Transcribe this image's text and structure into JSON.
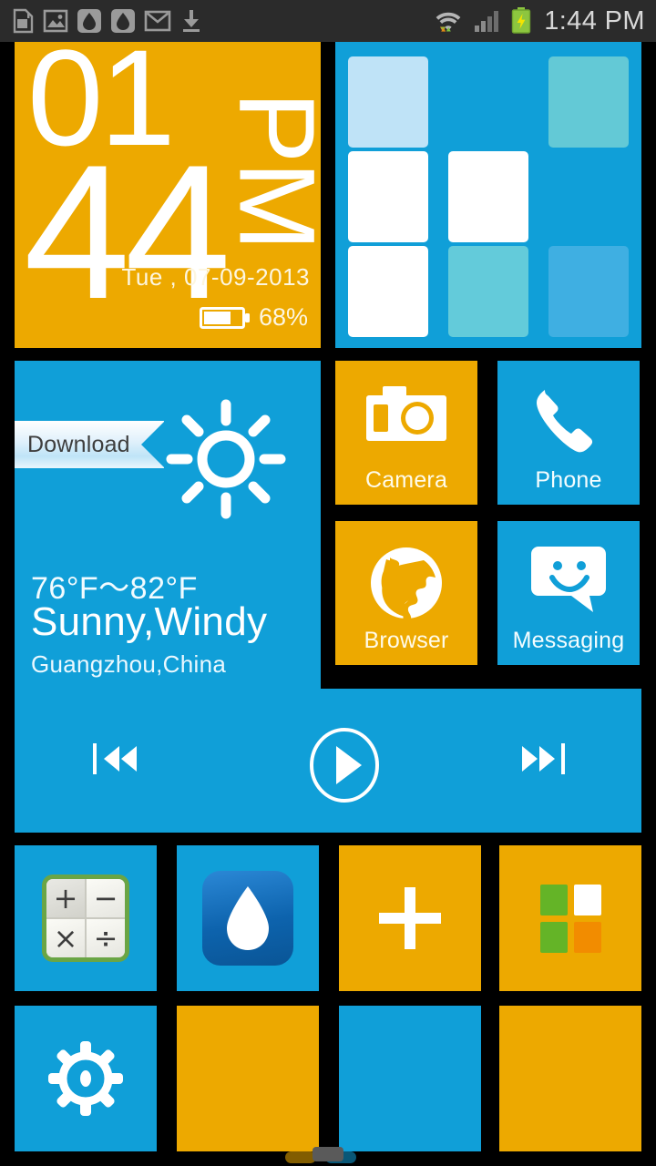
{
  "status_bar": {
    "time": "1:44 PM",
    "left_icons": [
      {
        "name": "sd-card-icon",
        "label": "SD card"
      },
      {
        "name": "gallery-image-icon",
        "label": "Gallery"
      },
      {
        "name": "water-drop-icon-1",
        "label": "Water drop"
      },
      {
        "name": "water-drop-icon-2",
        "label": "Water drop"
      },
      {
        "name": "gmail-icon",
        "label": "Gmail"
      },
      {
        "name": "download-icon",
        "label": "Download"
      }
    ],
    "right_icons": [
      {
        "name": "wifi-icon",
        "label": "Wi-Fi with data transfer"
      },
      {
        "name": "signal-icon",
        "label": "Cellular signal"
      },
      {
        "name": "battery-charging-icon",
        "label": "Battery charging"
      }
    ]
  },
  "clock_widget": {
    "hours": "01",
    "minutes": "44",
    "meridiem": "PM",
    "date": "Tue , 07-09-2013",
    "battery_percent": "68%"
  },
  "grid_widget": {
    "cells": [
      {
        "color": "#bfe3f7",
        "visible": true
      },
      {
        "color": "transparent",
        "visible": false
      },
      {
        "color": "#63c9d6",
        "visible": true
      },
      {
        "color": "#ffffff",
        "visible": true
      },
      {
        "color": "#ffffff",
        "visible": true
      },
      {
        "color": "transparent",
        "visible": false
      },
      {
        "color": "#ffffff",
        "visible": true
      },
      {
        "color": "#63cbda",
        "visible": true
      },
      {
        "color": "#3fafe2",
        "visible": true
      }
    ]
  },
  "weather_widget": {
    "ribbon_label": "Download",
    "temperature_range": "76°F～82°F",
    "condition": "Sunny,Windy",
    "location": "Guangzhou,China",
    "icon": "sun-icon"
  },
  "app_tiles": [
    {
      "name": "camera",
      "label": "Camera",
      "icon": "camera-icon",
      "color": "#eda900"
    },
    {
      "name": "phone",
      "label": "Phone",
      "icon": "phone-icon",
      "color": "#109fd8"
    },
    {
      "name": "browser",
      "label": "Browser",
      "icon": "globe-icon",
      "color": "#eda900"
    },
    {
      "name": "messaging",
      "label": "Messaging",
      "icon": "chat-smiley-icon",
      "color": "#109fd8"
    }
  ],
  "music_widget": {
    "previous_label": "Previous",
    "play_label": "Play",
    "next_label": "Next"
  },
  "bottom_tiles": [
    {
      "name": "calculator",
      "icon": "calculator-icon",
      "color": "#109fd8"
    },
    {
      "name": "water-drop-app",
      "icon": "water-drop-icon",
      "color": "#109fd8"
    },
    {
      "name": "add-tile",
      "icon": "plus-icon",
      "color": "#eda900"
    },
    {
      "name": "app-drawer",
      "icon": "four-squares-icon",
      "color": "#eda900"
    },
    {
      "name": "settings",
      "icon": "gear-icon",
      "color": "#109fd8"
    },
    {
      "name": "empty-tile-1",
      "icon": "",
      "color": "#eda900"
    },
    {
      "name": "empty-tile-2",
      "icon": "",
      "color": "#109fd8"
    },
    {
      "name": "empty-tile-3",
      "icon": "",
      "color": "#eda900"
    }
  ],
  "calculator_icon": {
    "operators": [
      "+",
      "−",
      "×",
      "÷"
    ]
  },
  "app_drawer_icon": {
    "squares": [
      "#64b427",
      "#ffffff",
      "#64b427",
      "#f28c00"
    ]
  },
  "theme": {
    "orange": "#eda900",
    "blue": "#109fd8",
    "background": "#000000",
    "status_bar": "#2b2b2b"
  }
}
